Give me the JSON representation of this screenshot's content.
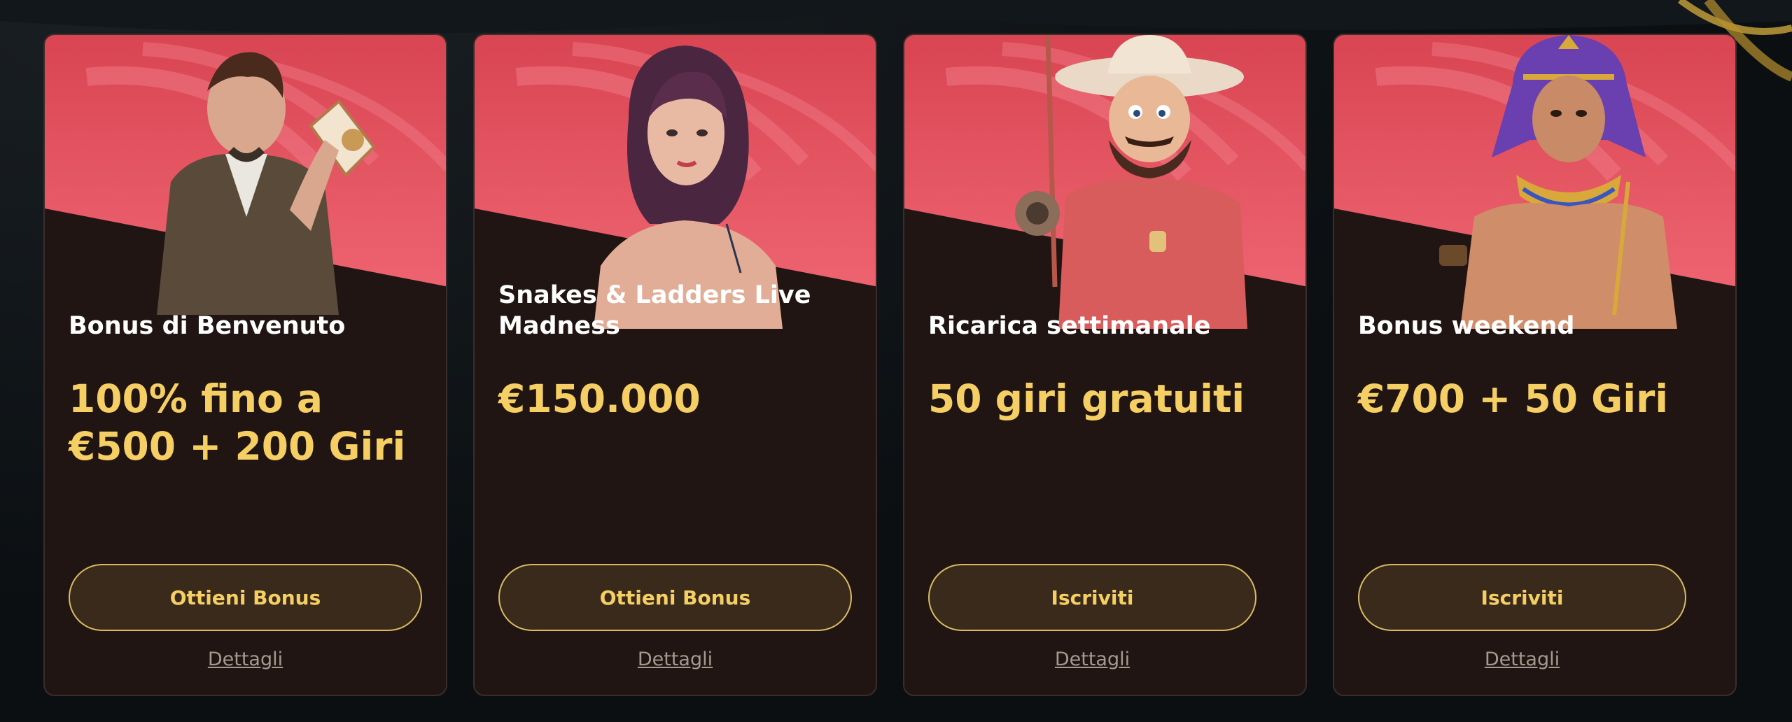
{
  "promos": [
    {
      "title": "Bonus di Benvenuto",
      "amount": "100% fino a €500 + 200 Giri",
      "cta_label": "Ottieni Bonus",
      "details_label": "Dettagli",
      "character": "explorer-character"
    },
    {
      "title": "Snakes & Ladders Live Madness",
      "amount": "€150.000",
      "cta_label": "Ottieni Bonus",
      "details_label": "Dettagli",
      "character": "woman-character"
    },
    {
      "title": "Ricarica settimanale",
      "amount": "50 giri gratuiti",
      "cta_label": "Iscriviti",
      "details_label": "Dettagli",
      "character": "cowboy-fisherman-character"
    },
    {
      "title": "Bonus weekend",
      "amount": "€700 + 50 Giri",
      "cta_label": "Iscriviti",
      "details_label": "Dettagli",
      "character": "pharaoh-character"
    }
  ],
  "colors": {
    "page_bg": "#0b0f12",
    "card_bg": "#211514",
    "hero_red": "#e2505c",
    "accent_gold": "#f5cf63",
    "cta_bg": "#3a2a1b",
    "title_text": "#ffffff",
    "details_text": "#a59a8c"
  }
}
